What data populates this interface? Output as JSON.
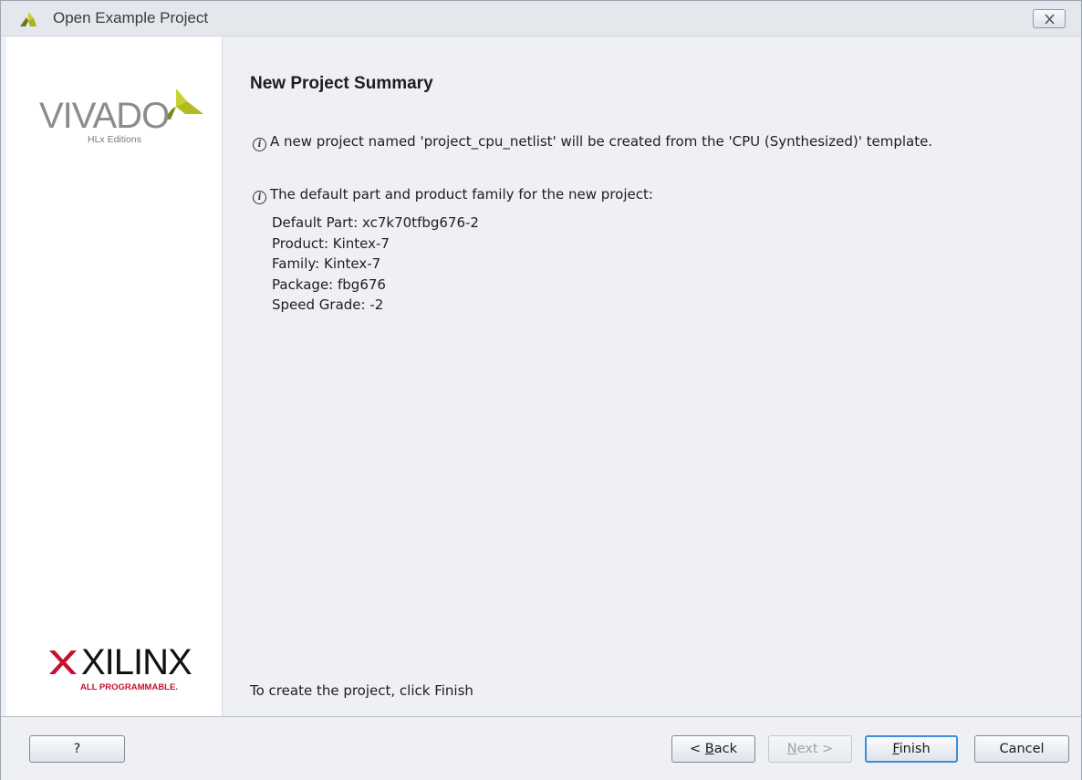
{
  "window": {
    "title": "Open Example Project",
    "accent_color": "#b9c21f"
  },
  "left_panel": {
    "vivado_logo": {
      "word": "VIVADO",
      "subtitle": "HLx Editions"
    },
    "xilinx_logo": {
      "word": "XILINX",
      "subtitle": "ALL PROGRAMMABLE."
    }
  },
  "content": {
    "heading": "New Project Summary",
    "info1": "A new project named 'project_cpu_netlist' will be created from the 'CPU (Synthesized)' template.",
    "info2": "The default part and product family for the new project:",
    "details": {
      "default_part": "Default Part: xc7k70tfbg676-2",
      "product": "Product: Kintex-7",
      "family": "Family: Kintex-7",
      "package": "Package: fbg676",
      "speed_grade": "Speed Grade: -2"
    },
    "footer_hint": "To create the project, click Finish"
  },
  "buttons": {
    "help": "?",
    "back": {
      "prefix": "< ",
      "mnemonic": "B",
      "rest": "ack"
    },
    "next": {
      "mnemonic": "N",
      "rest": "ext >"
    },
    "finish": {
      "mnemonic": "F",
      "rest": "inish"
    },
    "cancel": "Cancel"
  },
  "icons": {
    "title": "vivado-logo-icon",
    "close": "close-icon",
    "info": "info-icon"
  }
}
